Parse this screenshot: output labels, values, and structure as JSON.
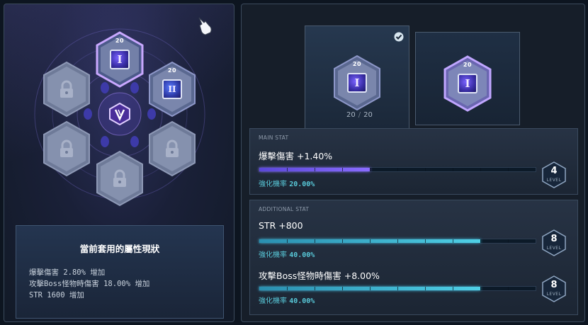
{
  "colors": {
    "accent_purple": "#8a6cff",
    "accent_cyan": "#3fb8d6",
    "rate_text": "#58c8d8"
  },
  "board": {
    "slots": [
      {
        "id": "top",
        "state": "equipped",
        "level_badge": "20",
        "glyph": "I"
      },
      {
        "id": "top-right",
        "state": "equipped",
        "level_badge": "20",
        "glyph": "II"
      },
      {
        "id": "top-left",
        "state": "locked",
        "icon": "lock-icon"
      },
      {
        "id": "bottom-left",
        "state": "locked",
        "icon": "lock-icon"
      },
      {
        "id": "bottom-right",
        "state": "locked",
        "icon": "lock-icon"
      },
      {
        "id": "bottom",
        "state": "locked",
        "icon": "lock-icon"
      }
    ],
    "center_icon": "v-emblem-icon"
  },
  "status": {
    "title": "當前套用的屬性現狀",
    "lines": [
      "爆擊傷害 2.80% 增加",
      "攻擊Boss怪物時傷害 18.00% 增加",
      "STR 1600 增加"
    ]
  },
  "compare": {
    "left_badge": "20",
    "left_glyph": "I",
    "right_badge": "20",
    "right_glyph": "I",
    "current": "20",
    "separator": "/",
    "max": "20",
    "check_icon": "check-icon"
  },
  "main_stat": {
    "section_label": "MAIN STAT",
    "name": "爆擊傷害 +1.40%",
    "rate_label": "強化機率",
    "rate_value": "20.00%",
    "level": "4",
    "level_label": "LEVEL",
    "progress": 0.4
  },
  "additional_stat": {
    "section_label": "ADDITIONAL STAT",
    "stats": [
      {
        "name": "STR +800",
        "rate_label": "強化機率",
        "rate_value": "40.00%",
        "level": "8",
        "level_label": "LEVEL",
        "progress": 0.8
      },
      {
        "name": "攻擊Boss怪物時傷害 +8.00%",
        "rate_label": "強化機率",
        "rate_value": "40.00%",
        "level": "8",
        "level_label": "LEVEL",
        "progress": 0.8
      }
    ]
  }
}
